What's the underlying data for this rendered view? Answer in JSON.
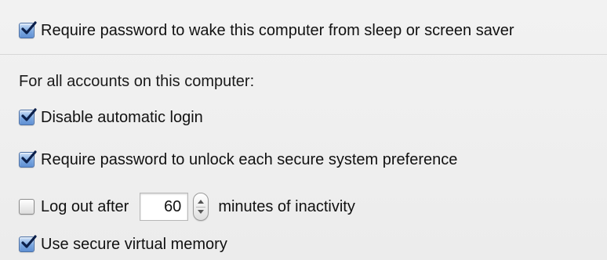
{
  "security_options": {
    "require_password_wake": {
      "checked": true,
      "label": "Require password to wake this computer from sleep or screen saver"
    },
    "all_accounts_label": "For all accounts on this computer:",
    "disable_automatic_login": {
      "checked": true,
      "label": "Disable automatic login"
    },
    "require_password_unlock": {
      "checked": true,
      "label": "Require password to unlock each secure system preference"
    },
    "log_out_after": {
      "checked": false,
      "label": "Log out after",
      "minutes_value": "60",
      "suffix": "minutes of inactivity"
    },
    "secure_virtual_memory": {
      "checked": true,
      "label": "Use secure virtual memory"
    }
  }
}
